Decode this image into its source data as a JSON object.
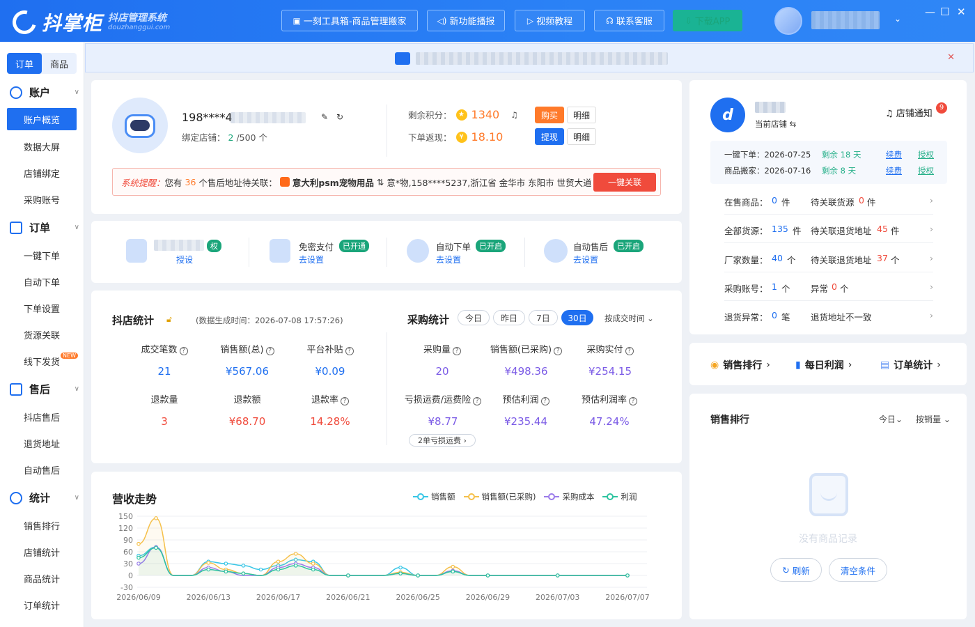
{
  "app": {
    "logo_text": "抖掌柜",
    "logo_sub_cn": "抖店管理系统",
    "logo_sub_en": "douzhanggui.com"
  },
  "top_buttons": [
    "一刻工具箱-商品管理搬家",
    "新功能播报",
    "视频教程",
    "联系客服",
    "下载APP"
  ],
  "sidebar": {
    "tabs": [
      "订单",
      "商品"
    ],
    "groups": {
      "account": {
        "label": "账户",
        "items": [
          "账户概览",
          "数据大屏",
          "店铺绑定",
          "采购账号"
        ]
      },
      "order": {
        "label": "订单",
        "items": [
          "一键下单",
          "自动下单",
          "下单设置",
          "货源关联",
          "线下发货"
        ]
      },
      "aftersale": {
        "label": "售后",
        "items": [
          "抖店售后",
          "退货地址",
          "自动售后"
        ]
      },
      "stats": {
        "label": "统计",
        "items": [
          "销售排行",
          "店铺统计",
          "商品统计",
          "订单统计"
        ]
      }
    },
    "new_badge": "NEW"
  },
  "profile": {
    "phone": "198****4",
    "bind_label": "绑定店铺：",
    "bind_count": "2",
    "bind_total": "/500 个",
    "points_label": "剩余积分：",
    "points": "1340",
    "rebate_label": "下单返现：",
    "rebate": "18.10",
    "buy_btn": "购买",
    "detail_btn": "明细",
    "withdraw_btn": "提现",
    "detail_btn2": "明细"
  },
  "alert": {
    "prefix": "系统提醒：",
    "text1": "您有",
    "count": "36",
    "text2": "个售后地址待关联：",
    "shop": "意大利psm宠物用品",
    "address": "意*物,158****5237,浙江省 金华市 东阳市 世贸大道",
    "action": "一键关联"
  },
  "features": [
    {
      "title": "",
      "status": "权",
      "sub": "授设"
    },
    {
      "title": "免密支付",
      "status": "已开通",
      "sub": "去设置"
    },
    {
      "title": "自动下单",
      "status": "已开启",
      "sub": "去设置"
    },
    {
      "title": "自动售后",
      "status": "已开启",
      "sub": "去设置"
    }
  ],
  "store_stats": {
    "title": "抖店统计",
    "gen_time": "(数据生成时间：2026-07-08 17:57:26)",
    "items": [
      {
        "label": "成交笔数",
        "value": "21",
        "q": true
      },
      {
        "label": "销售额(总)",
        "value": "¥567.06",
        "q": true
      },
      {
        "label": "平台补贴",
        "value": "¥0.09",
        "q": true
      },
      {
        "label": "退款量",
        "value": "3",
        "q": false
      },
      {
        "label": "退款额",
        "value": "¥68.70",
        "q": false
      },
      {
        "label": "退款率",
        "value": "14.28%",
        "q": true
      }
    ]
  },
  "purchase_stats": {
    "title": "采购统计",
    "ranges": [
      "今日",
      "昨日",
      "7日",
      "30日"
    ],
    "sort": "按成交时间",
    "items": [
      {
        "label": "采购量",
        "value": "20"
      },
      {
        "label": "销售额(已采购)",
        "value": "¥498.36"
      },
      {
        "label": "采购实付",
        "value": "¥254.15"
      },
      {
        "label": "亏损运费/运费险",
        "value": "¥8.77"
      },
      {
        "label": "预估利润",
        "value": "¥235.44"
      },
      {
        "label": "预估利润率",
        "value": "47.24%"
      }
    ],
    "loss_pill": "2单亏损运费"
  },
  "trend": {
    "title": "营收走势",
    "legend": [
      "销售额",
      "销售额(已采购)",
      "采购成本",
      "利润"
    ]
  },
  "chart_data": {
    "type": "line",
    "x": [
      "2026/06/09",
      "2026/06/10",
      "2026/06/11",
      "2026/06/12",
      "2026/06/13",
      "2026/06/14",
      "2026/06/15",
      "2026/06/16",
      "2026/06/17",
      "2026/06/18",
      "2026/06/19",
      "2026/06/20",
      "2026/06/21",
      "2026/06/22",
      "2026/06/23",
      "2026/06/24",
      "2026/06/25",
      "2026/06/26",
      "2026/06/27",
      "2026/06/28",
      "2026/06/29",
      "2026/06/30",
      "2026/07/01",
      "2026/07/02",
      "2026/07/03",
      "2026/07/04",
      "2026/07/05",
      "2026/07/06",
      "2026/07/07"
    ],
    "xticks": [
      "2026/06/09",
      "2026/06/13",
      "2026/06/17",
      "2026/06/21",
      "2026/06/25",
      "2026/06/29",
      "2026/07/03",
      "2026/07/07"
    ],
    "ylim": [
      -30,
      150
    ],
    "yticks": [
      150,
      120,
      90,
      60,
      30,
      0,
      -30
    ],
    "series": [
      {
        "name": "销售额",
        "color": "#38c6e6",
        "values": [
          50,
          72,
          0,
          0,
          35,
          30,
          25,
          15,
          25,
          40,
          35,
          0,
          0,
          0,
          0,
          20,
          0,
          0,
          10,
          0,
          0,
          0,
          0,
          0,
          0,
          0,
          0,
          0,
          0
        ]
      },
      {
        "name": "销售额(已采购)",
        "color": "#f5c04a",
        "values": [
          80,
          145,
          0,
          0,
          32,
          15,
          5,
          0,
          35,
          55,
          30,
          0,
          0,
          0,
          0,
          8,
          0,
          0,
          22,
          0,
          0,
          0,
          0,
          0,
          0,
          0,
          0,
          0,
          0
        ]
      },
      {
        "name": "采购成本",
        "color": "#9b7bea",
        "values": [
          30,
          72,
          0,
          0,
          20,
          10,
          0,
          0,
          20,
          30,
          20,
          0,
          0,
          0,
          0,
          5,
          0,
          0,
          12,
          0,
          0,
          0,
          0,
          0,
          0,
          0,
          0,
          0,
          0
        ]
      },
      {
        "name": "利润",
        "color": "#2ec4a0",
        "values": [
          45,
          70,
          0,
          0,
          15,
          10,
          5,
          0,
          15,
          25,
          15,
          0,
          0,
          0,
          0,
          5,
          0,
          0,
          10,
          0,
          0,
          0,
          0,
          0,
          0,
          0,
          0,
          0,
          0
        ]
      }
    ]
  },
  "store_panel": {
    "current_shop": "当前店铺",
    "notify": "店铺通知",
    "notify_count": "9",
    "sub1_label": "一键下单：",
    "sub1_date": "2026-07-25",
    "sub1_left": "剩余 18 天",
    "sub2_label": "商品搬家：",
    "sub2_date": "2026-07-16",
    "sub2_left": "剩余 8 天",
    "renew": "续费",
    "auth": "授权",
    "rows": [
      {
        "l1": "在售商品：",
        "v1": "0",
        "u1": "件",
        "l2": "待关联货源",
        "v2": "0",
        "u2": "件"
      },
      {
        "l1": "全部货源：",
        "v1": "135",
        "u1": "件",
        "l2": "待关联退货地址",
        "v2": "45",
        "u2": "件"
      },
      {
        "l1": "厂家数量：",
        "v1": "40",
        "u1": "个",
        "l2": "待关联退货地址",
        "v2": "37",
        "u2": "个"
      },
      {
        "l1": "采购账号：",
        "v1": "1",
        "u1": "个",
        "l2": "异常",
        "v2": "0",
        "u2": "个"
      },
      {
        "l1": "退货异常：",
        "v1": "0",
        "u1": "笔",
        "l2": "退货地址不一致",
        "v2": "",
        "u2": ""
      }
    ]
  },
  "quick_links": [
    "销售排行",
    "每日利润",
    "订单统计"
  ],
  "ranking": {
    "title": "销售排行",
    "filter1": "今日",
    "filter2": "按销量",
    "empty": "没有商品记录",
    "refresh": "刷新",
    "clear": "清空条件"
  }
}
